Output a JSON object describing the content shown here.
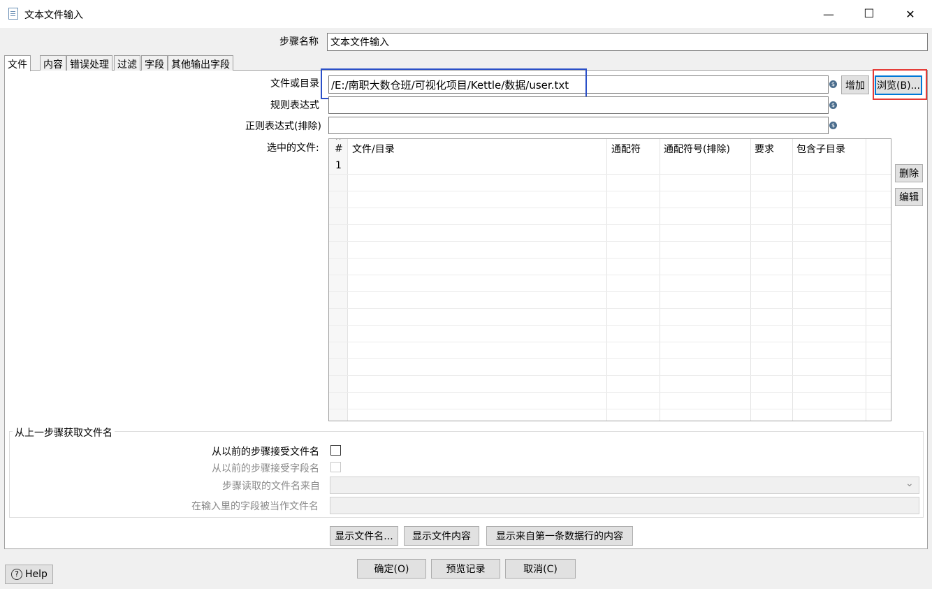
{
  "window": {
    "title": "文本文件输入",
    "minimize": "—",
    "maximize": "☐",
    "close": "✕"
  },
  "step_name": {
    "label": "步骤名称",
    "value": "文本文件输入"
  },
  "tabs": [
    {
      "label": "文件"
    },
    {
      "label": "内容"
    },
    {
      "label": "错误处理"
    },
    {
      "label": "过滤"
    },
    {
      "label": "字段"
    },
    {
      "label": "其他输出字段"
    }
  ],
  "file_tab": {
    "file_or_dir_label": "文件或目录",
    "file_or_dir_value": "/E:/南职大数仓班/可视化项目/Kettle/数据/user.txt",
    "add_button": "增加",
    "browse_button": "浏览(B)...",
    "regex_label": "规则表达式",
    "regex_value": "",
    "regex_exclude_label": "正则表达式(排除)",
    "regex_exclude_value": "",
    "selected_files_label": "选中的文件:",
    "delete_button": "删除",
    "edit_button": "编辑",
    "grid": {
      "sort_indicator": "^",
      "columns": [
        "#",
        "文件/目录",
        "通配符",
        "通配符号(排除)",
        "要求",
        "包含子目录"
      ],
      "rows": [
        {
          "num": "1"
        }
      ]
    },
    "prev_step_group": {
      "title": "从上一步骤获取文件名",
      "accept_filenames_label": "从以前的步骤接受文件名",
      "accept_fieldnames_label": "从以前的步骤接受字段名",
      "step_source_label": "步骤读取的文件名来自",
      "field_as_filename_label": "在输入里的字段被当作文件名",
      "dropdown_arrow": "⌄"
    },
    "show_filenames_button": "显示文件名...",
    "show_content_button": "显示文件内容",
    "show_first_row_button": "显示来自第一条数据行的内容"
  },
  "footer": {
    "ok_button": "确定(O)",
    "preview_button": "预览记录",
    "cancel_button": "取消(C)",
    "help_button": "Help",
    "help_icon": "?"
  },
  "variable_icon": "$",
  "colors": {
    "highlight_blue": "#2b50c8",
    "highlight_red": "#e53935",
    "focus_blue": "#0078d7"
  }
}
